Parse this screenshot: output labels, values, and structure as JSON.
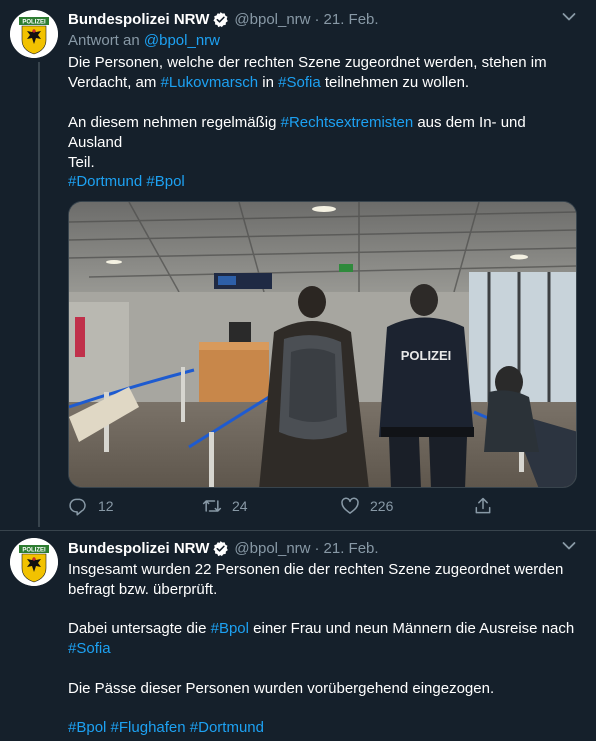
{
  "tweets": [
    {
      "author_name": "Bundespolizei NRW",
      "handle": "@bpol_nrw",
      "separator": "·",
      "date": "21. Feb.",
      "reply_prefix": "Antwort an",
      "reply_handle": "@bpol_nrw",
      "line1": "Die Personen,  welche der rechten Szene zugeordnet werden, stehen im",
      "line2_a": "Verdacht, am ",
      "line2_tag1": "#Lukovmarsch",
      "line2_b": " in ",
      "line2_tag2": "#Sofia",
      "line2_c": " teilnehmen zu wollen.",
      "line3_a": "An diesem nehmen regelmäßig ",
      "line3_tag": "#Rechtsextremisten",
      "line3_b": " aus dem In- und Ausland",
      "line4": "Teil.",
      "tag_dortmund": "#Dortmund",
      "tag_bpol": "#Bpol",
      "photo_sign_text": "POLIZEI",
      "reply_count": "12",
      "retweet_count": "24",
      "like_count": "226"
    },
    {
      "author_name": "Bundespolizei NRW",
      "handle": "@bpol_nrw",
      "separator": "·",
      "date": "21. Feb.",
      "line1": "Insgesamt wurden 22 Personen die der rechten Szene zugeordnet werden",
      "line2": "befragt bzw. überprüft.",
      "line3_a": "Dabei untersagte die ",
      "line3_tag": "#Bpol",
      "line3_b": " einer Frau und neun Männern die Ausreise nach",
      "line4_tag": "#Sofia",
      "line5": "Die Pässe dieser Personen wurden vorübergehend eingezogen.",
      "tag_bpol": "#Bpol",
      "tag_flughafen": "#Flughafen",
      "tag_dortmund": "#Dortmund"
    }
  ],
  "avatar_badge_text": "POLIZEI",
  "colors": {
    "background": "#15202b",
    "text": "#ffffff",
    "secondary_text": "#8899a6",
    "link": "#1da1f2",
    "divider": "#38444d"
  },
  "icons": [
    "verified-badge-icon",
    "chevron-down-icon",
    "reply-icon",
    "retweet-icon",
    "like-icon",
    "share-icon"
  ]
}
